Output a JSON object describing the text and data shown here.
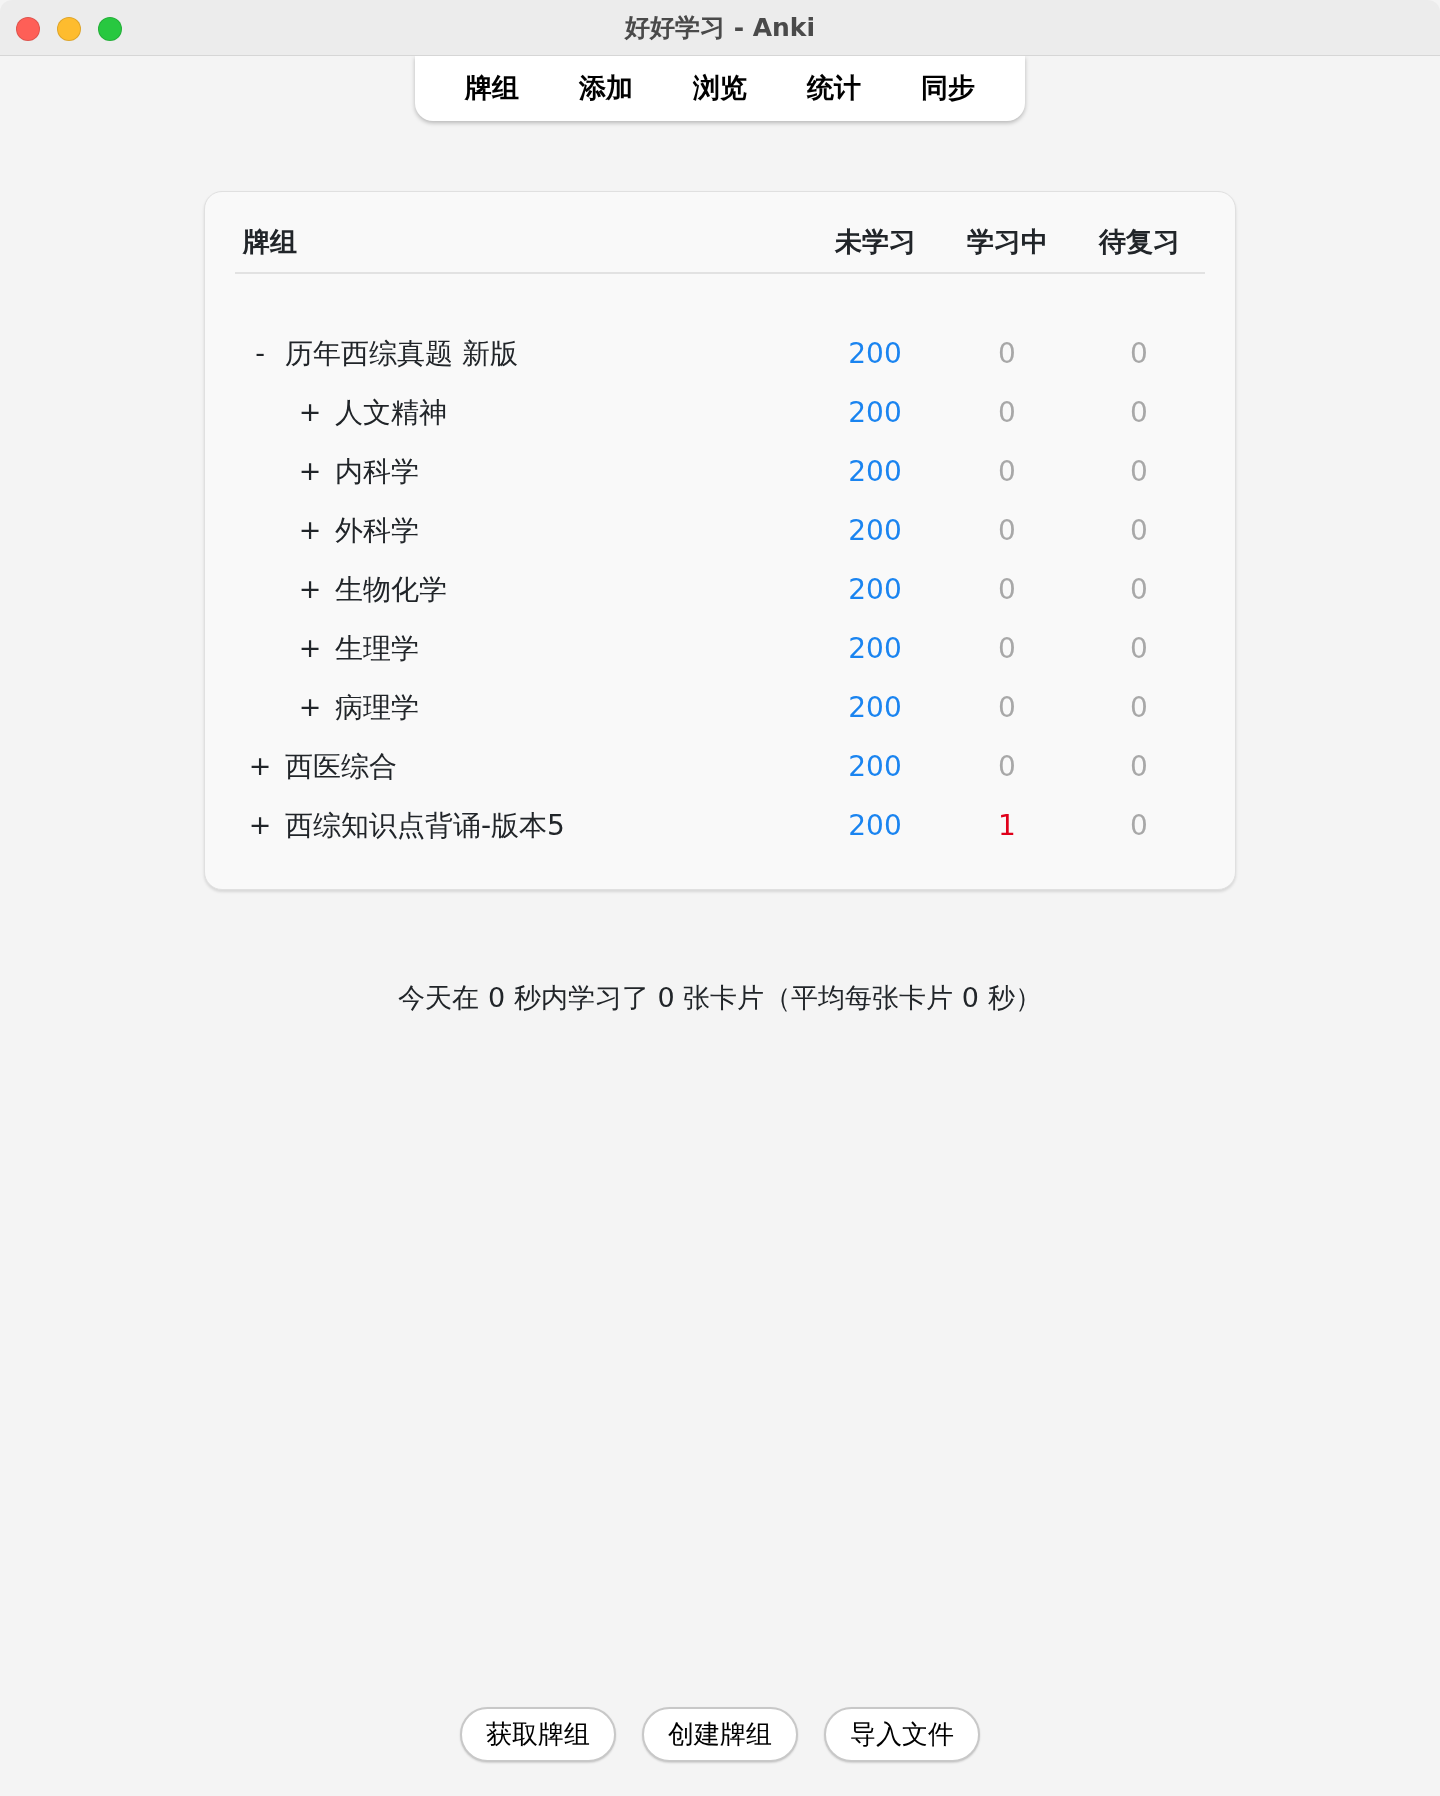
{
  "window": {
    "title": "好好学习 - Anki"
  },
  "toolbar": [
    {
      "label": "牌组"
    },
    {
      "label": "添加"
    },
    {
      "label": "浏览"
    },
    {
      "label": "统计"
    },
    {
      "label": "同步"
    }
  ],
  "deck_table": {
    "columns": [
      "牌组",
      "未学习",
      "学习中",
      "待复习"
    ],
    "decks": [
      {
        "expander": "-",
        "name": "历年西综真题 新版",
        "counts": [
          {
            "value": "200",
            "color": "#1a84f0"
          },
          {
            "value": "0",
            "color": "#a8a8a8"
          },
          {
            "value": "0",
            "color": "#a8a8a8"
          }
        ],
        "children": [
          {
            "expander": "+",
            "name": "人文精神",
            "counts": [
              {
                "value": "200",
                "color": "#1a84f0"
              },
              {
                "value": "0",
                "color": "#a8a8a8"
              },
              {
                "value": "0",
                "color": "#a8a8a8"
              }
            ]
          },
          {
            "expander": "+",
            "name": "内科学",
            "counts": [
              {
                "value": "200",
                "color": "#1a84f0"
              },
              {
                "value": "0",
                "color": "#a8a8a8"
              },
              {
                "value": "0",
                "color": "#a8a8a8"
              }
            ]
          },
          {
            "expander": "+",
            "name": "外科学",
            "counts": [
              {
                "value": "200",
                "color": "#1a84f0"
              },
              {
                "value": "0",
                "color": "#a8a8a8"
              },
              {
                "value": "0",
                "color": "#a8a8a8"
              }
            ]
          },
          {
            "expander": "+",
            "name": "生物化学",
            "counts": [
              {
                "value": "200",
                "color": "#1a84f0"
              },
              {
                "value": "0",
                "color": "#a8a8a8"
              },
              {
                "value": "0",
                "color": "#a8a8a8"
              }
            ]
          },
          {
            "expander": "+",
            "name": "生理学",
            "counts": [
              {
                "value": "200",
                "color": "#1a84f0"
              },
              {
                "value": "0",
                "color": "#a8a8a8"
              },
              {
                "value": "0",
                "color": "#a8a8a8"
              }
            ]
          },
          {
            "expander": "+",
            "name": "病理学",
            "counts": [
              {
                "value": "200",
                "color": "#1a84f0"
              },
              {
                "value": "0",
                "color": "#a8a8a8"
              },
              {
                "value": "0",
                "color": "#a8a8a8"
              }
            ]
          }
        ]
      },
      {
        "expander": "+",
        "name": "西医综合",
        "counts": [
          {
            "value": "200",
            "color": "#1a84f0"
          },
          {
            "value": "0",
            "color": "#a8a8a8"
          },
          {
            "value": "0",
            "color": "#a8a8a8"
          }
        ]
      },
      {
        "expander": "+",
        "name": "西综知识点背诵-版本5",
        "counts": [
          {
            "value": "200",
            "color": "#1a84f0"
          },
          {
            "value": "1",
            "color": "#e0001a"
          },
          {
            "value": "0",
            "color": "#a8a8a8"
          }
        ]
      }
    ]
  },
  "study_summary": "今天在 0 秒内学习了 0 张卡片（平均每张卡片 0 秒）",
  "buttons": [
    {
      "label": "获取牌组"
    },
    {
      "label": "创建牌组"
    },
    {
      "label": "导入文件"
    }
  ]
}
